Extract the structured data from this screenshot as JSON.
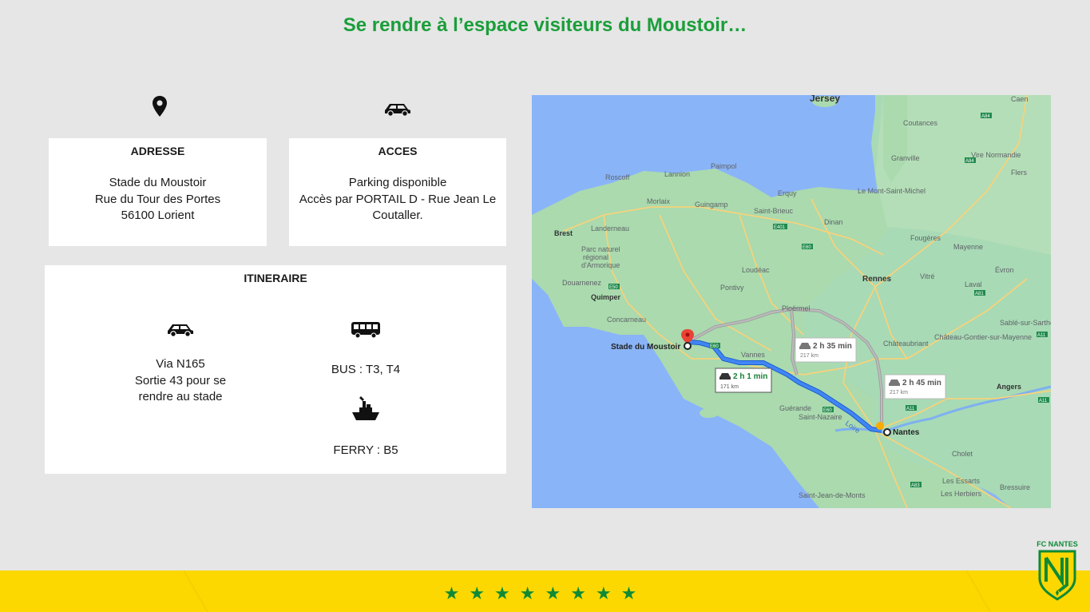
{
  "title": "Se rendre à l’espace visiteurs du Moustoir…",
  "icons": {
    "address": "map-pin-icon",
    "access": "car-icon",
    "itinerary_car": "car-icon",
    "bus": "bus-icon",
    "ferry": "ferry-icon"
  },
  "address": {
    "heading": "ADRESSE",
    "lines": [
      "Stade du Moustoir",
      "Rue du Tour des Portes",
      "56100 Lorient"
    ]
  },
  "access": {
    "heading": "ACCES",
    "lines": [
      "Parking disponible",
      "Accès par PORTAIL D - Rue Jean Le",
      "Coutaller."
    ]
  },
  "itinerary": {
    "heading": "ITINERAIRE",
    "car_lines": [
      "Via N165",
      "Sortie 43 pour se",
      "rendre au stade"
    ],
    "bus": "BUS : T3, T4",
    "ferry": "FERRY : B5"
  },
  "map": {
    "places": {
      "jersey": "Jersey",
      "caen": "Caen",
      "coutances": "Coutances",
      "granville": "Granville",
      "vire": "Vire Normandie",
      "flers": "Flers",
      "roscoff": "Roscoff",
      "lannion": "Lannion",
      "paimpol": "Paimpol",
      "morlaix": "Morlaix",
      "guingamp": "Guingamp",
      "saint_brieuc": "Saint-Brieuc",
      "erquy": "Erquy",
      "mont_saint_michel": "Le Mont-Saint-Michel",
      "landerneau": "Landerneau",
      "brest": "Brest",
      "dinan": "Dinan",
      "fougeres": "Fougères",
      "parc": "Parc naturel",
      "parc2": "régional",
      "parc3": "d'Armorique",
      "douarnenez": "Douarnenez",
      "pontivy": "Pontivy",
      "loudeac": "Loudéac",
      "rennes": "Rennes",
      "vitre": "Vitré",
      "mayenne": "Mayenne",
      "evron": "Évron",
      "laval": "Laval",
      "quimper": "Quimper",
      "concarneau": "Concarneau",
      "ploermel": "Ploërmel",
      "vannes": "Vannes",
      "chateaubriant": "Châteaubriant",
      "sable": "Sablé-sur-Sarthe",
      "chateau_gontier": "Château-Gontier-sur-Mayenne",
      "angers": "Angers",
      "guerande": "Guérande",
      "saint_nazaire": "Saint-Nazaire",
      "nantes": "Nantes",
      "cholet": "Cholet",
      "les_essarts": "Les Essarts",
      "les_herbiers": "Les Herbiers",
      "bressuire": "Bressuire",
      "saint_jean": "Saint-Jean-de-Monts",
      "loire": "Loire",
      "stade": "Stade du Moustoir"
    },
    "roads": [
      "A84",
      "A84",
      "E401",
      "E60",
      "E50",
      "E60",
      "A11",
      "A11",
      "A83",
      "A81",
      "A11",
      "E60"
    ],
    "routes": [
      {
        "time": "2 h 1 min",
        "distance": "171 km",
        "selected": true
      },
      {
        "time": "2 h 35 min",
        "distance": "217 km",
        "selected": false
      },
      {
        "time": "2 h 45 min",
        "distance": "217 km",
        "selected": false
      }
    ]
  },
  "footer": {
    "stars": "★★★★★★★★"
  },
  "logo": {
    "text": "FC NANTES",
    "letters": "NF"
  },
  "colors": {
    "title_green": "#1a9e3a",
    "footer_yellow": "#fcd800",
    "star_green": "#0e8a36",
    "route_blue": "#4285f4"
  }
}
